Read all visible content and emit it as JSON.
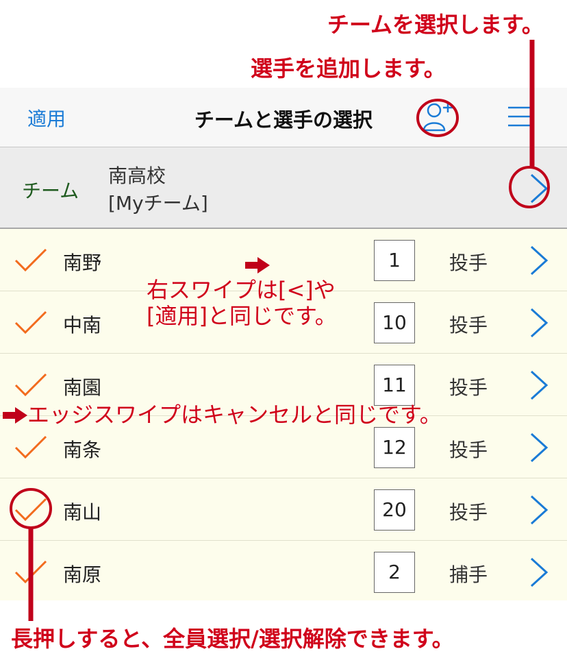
{
  "annotations": {
    "select_team": "チームを選択します。",
    "add_player": "選手を追加します。",
    "swipe_right": "右スワイプは[<]や",
    "swipe_right_2": "[適用]と同じです。",
    "edge_swipe": "エッジスワイプはキャンセルと同じです。",
    "long_press": "長押しすると、全員選択/選択解除できます。",
    "color": "#d0021b"
  },
  "navbar": {
    "apply_label": "適用",
    "title": "チームと選手の選択",
    "add_player_icon": "person-add-icon",
    "menu_icon": "hamburger-menu-icon"
  },
  "team": {
    "label": "チーム",
    "name": "南高校",
    "sub": "[Myチーム]"
  },
  "players": [
    {
      "name": "南野",
      "number": "1",
      "position": "投手",
      "checked": true
    },
    {
      "name": "中南",
      "number": "10",
      "position": "投手",
      "checked": true
    },
    {
      "name": "南園",
      "number": "11",
      "position": "投手",
      "checked": true
    },
    {
      "name": "南条",
      "number": "12",
      "position": "投手",
      "checked": true
    },
    {
      "name": "南山",
      "number": "20",
      "position": "投手",
      "checked": true
    },
    {
      "name": "南原",
      "number": "2",
      "position": "捕手",
      "checked": true
    }
  ],
  "colors": {
    "accent_blue": "#1a7bd6",
    "check_orange": "#f26b1d",
    "team_green": "#1e5a1e"
  }
}
